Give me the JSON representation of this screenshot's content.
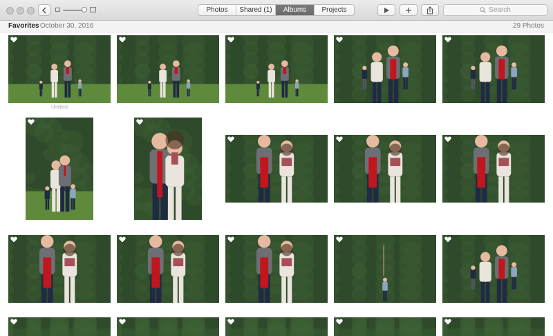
{
  "toolbar": {
    "back_icon": "chevron-left-icon",
    "tabs": [
      {
        "label": "Photos",
        "active": false
      },
      {
        "label": "Shared (1)",
        "active": false
      },
      {
        "label": "Albums",
        "active": true
      },
      {
        "label": "Projects",
        "active": false
      }
    ],
    "search_placeholder": "Search",
    "icons": [
      "play-icon",
      "plus-icon",
      "share-icon",
      "search-icon"
    ]
  },
  "header": {
    "title": "Favorites",
    "date": "October 30, 2016",
    "count": "29 Photos"
  },
  "photos": [
    {
      "kind": "family",
      "favorite": true,
      "caption": "Untitled"
    },
    {
      "kind": "family",
      "favorite": true,
      "caption": ""
    },
    {
      "kind": "family",
      "favorite": true,
      "caption": ""
    },
    {
      "kind": "family-close",
      "favorite": true,
      "caption": ""
    },
    {
      "kind": "family-close",
      "favorite": true,
      "caption": ""
    },
    {
      "kind": "family-portrait",
      "favorite": true,
      "caption": ""
    },
    {
      "kind": "couple-portrait",
      "favorite": true,
      "caption": ""
    },
    {
      "kind": "couple",
      "favorite": true,
      "caption": ""
    },
    {
      "kind": "couple",
      "favorite": true,
      "caption": ""
    },
    {
      "kind": "couple",
      "favorite": true,
      "caption": ""
    },
    {
      "kind": "couple",
      "favorite": true,
      "caption": ""
    },
    {
      "kind": "couple-wide",
      "favorite": true,
      "caption": ""
    },
    {
      "kind": "couple",
      "favorite": true,
      "caption": ""
    },
    {
      "kind": "child",
      "favorite": true,
      "caption": ""
    },
    {
      "kind": "family-close",
      "favorite": true,
      "caption": ""
    },
    {
      "kind": "partial",
      "favorite": true,
      "caption": ""
    },
    {
      "kind": "partial",
      "favorite": true,
      "caption": ""
    },
    {
      "kind": "partial",
      "favorite": true,
      "caption": ""
    },
    {
      "kind": "partial",
      "favorite": true,
      "caption": ""
    },
    {
      "kind": "partial",
      "favorite": true,
      "caption": ""
    }
  ],
  "colors": {
    "hedge": "#2e4a2a",
    "hedge_light": "#3f6136",
    "grass": "#5f8a3c",
    "red_sweater": "#c0161d",
    "grey_coat": "#6e6f74",
    "navy": "#1f2a44",
    "cream": "#e9e4dc"
  }
}
